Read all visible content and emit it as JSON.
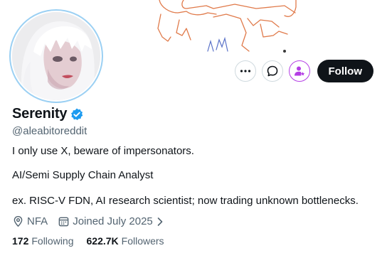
{
  "profile": {
    "name": "Serenity",
    "handle": "@aleabitoreddit",
    "bio_lines": [
      "I only use X, beware of impersonators.",
      "AI/Semi Supply Chain Analyst",
      "ex. RISC-V FDN, AI research scientist; now trading unknown bottlenecks."
    ],
    "location": "NFA",
    "joined": "Joined July 2025",
    "following_count": "172",
    "following_label": "Following",
    "followers_count": "622.7K",
    "followers_label": "Followers"
  },
  "actions": {
    "follow_label": "Follow",
    "more_icon": "more-icon",
    "message_icon": "message-icon",
    "subscribe_icon": "subscribe-icon"
  },
  "colors": {
    "verified": "#1d9bf0",
    "follow_bg": "#0f1419",
    "subscribe": "#b43ee5",
    "secondary_text": "#536471",
    "avatar_ring": "#9bd0f3"
  }
}
